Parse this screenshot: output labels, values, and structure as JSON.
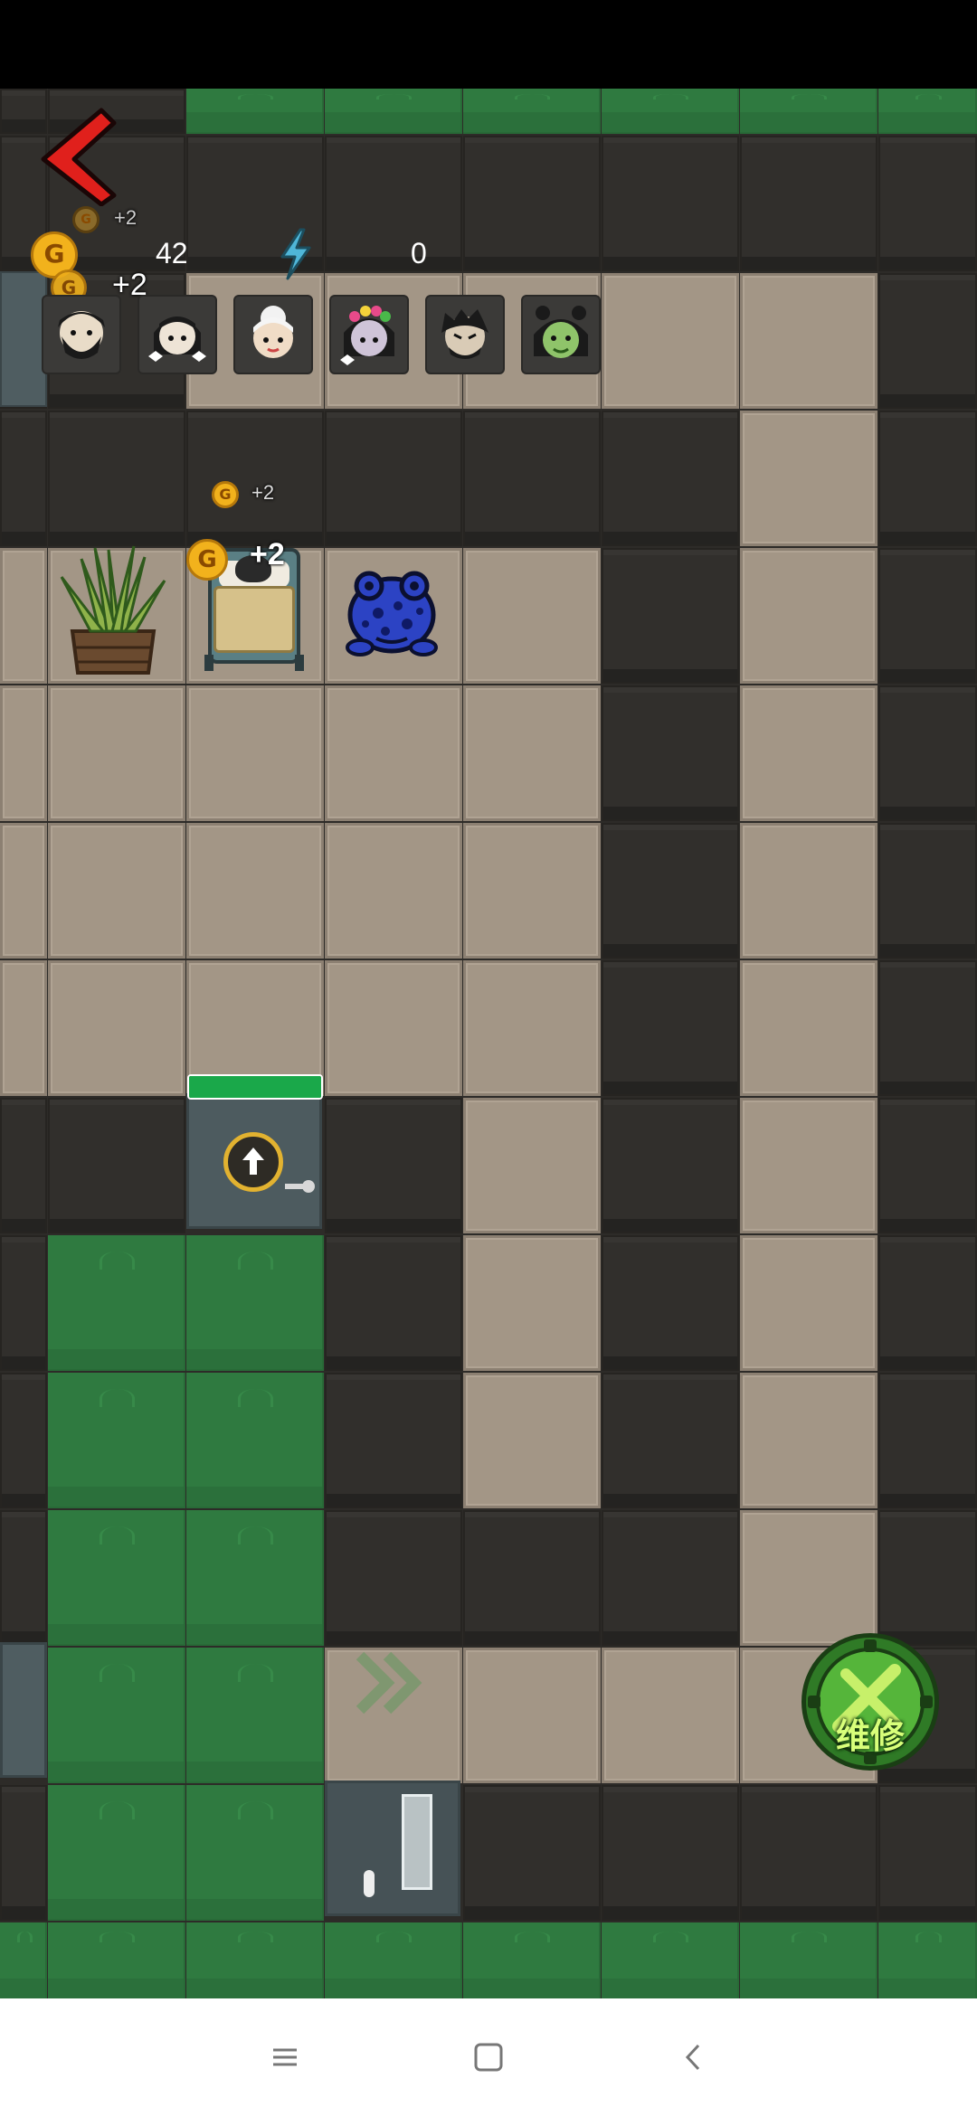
{
  "hud": {
    "gold_value": "42",
    "energy_value": "0",
    "coin_symbol": "G",
    "income_small": "+2",
    "income_hud": "+2",
    "back_icon": "red-chevron-left-icon",
    "energy_icon": "lightning-icon"
  },
  "party": {
    "members": [
      {
        "name": "bearded-man-avatar"
      },
      {
        "name": "girl-with-bows-avatar"
      },
      {
        "name": "grandma-avatar"
      },
      {
        "name": "flower-crown-girl-avatar"
      },
      {
        "name": "grumpy-man-avatar"
      },
      {
        "name": "green-faced-girl-avatar"
      }
    ]
  },
  "board": {
    "room_income_small": "+2",
    "bed_income": "+2",
    "door_icon": "up-arrow-icon",
    "door_health": 1.0,
    "repair_label": "维修"
  },
  "colors": {
    "wall": "#312f2c",
    "floor": "#a39686",
    "grass": "#2f7a40",
    "coin": "#f2b21c",
    "repair": "#3f9a2f",
    "back_arrow": "#e0201c"
  },
  "navbar": {
    "menu_icon": "menu-icon",
    "home_icon": "home-square-icon",
    "back_icon": "back-chevron-icon"
  }
}
